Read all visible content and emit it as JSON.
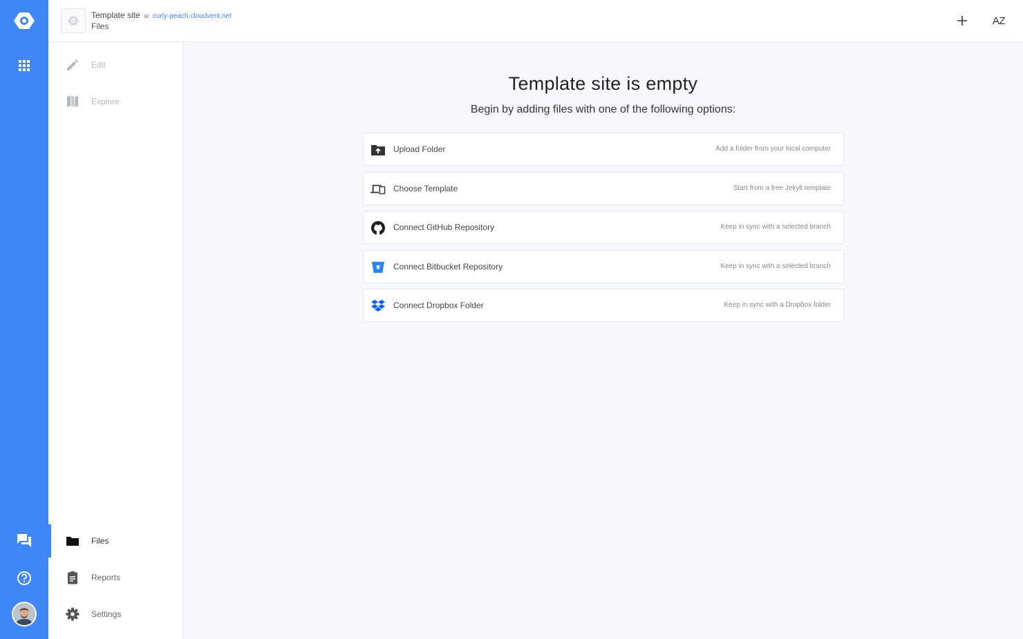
{
  "header": {
    "site_name": "Template site",
    "at_label": "at",
    "site_domain": "curly-peach.cloudvent.net",
    "section": "Files",
    "add_icon": "plus-icon",
    "sort_icon": "sort-az-icon",
    "sort_label": "AZ"
  },
  "rail": {
    "logo_icon": "cloudcannon-logo-icon",
    "apps_icon": "grid-icon",
    "chat_icon": "chat-icon",
    "help_icon": "help-circle-icon",
    "avatar_icon": "user-avatar"
  },
  "sidebar": {
    "top_items": [
      {
        "label": "Edit",
        "icon": "pencil-icon"
      },
      {
        "label": "Explore",
        "icon": "map-icon"
      }
    ],
    "bottom_items": [
      {
        "label": "Files",
        "icon": "folder-icon",
        "active": true
      },
      {
        "label": "Reports",
        "icon": "clipboard-icon"
      },
      {
        "label": "Settings",
        "icon": "gear-icon"
      }
    ]
  },
  "main": {
    "title": "Template site is empty",
    "subtitle": "Begin by adding files with one of the following options:",
    "options": [
      {
        "label": "Upload Folder",
        "description": "Add a folder from your local computer",
        "icon": "folder-upload-icon"
      },
      {
        "label": "Choose Template",
        "description": "Start from a free Jekyll template",
        "icon": "devices-icon"
      },
      {
        "label": "Connect GitHub Repository",
        "description": "Keep in sync with a selected branch",
        "icon": "github-icon"
      },
      {
        "label": "Connect Bitbucket Repository",
        "description": "Keep in sync with a selected branch",
        "icon": "bitbucket-icon"
      },
      {
        "label": "Connect Dropbox Folder",
        "description": "Keep in sync with a Dropbox folder",
        "icon": "dropbox-icon"
      }
    ]
  },
  "colors": {
    "accent": "#3f86f6",
    "background": "#f6f8fd",
    "bitbucket": "#2684ff",
    "dropbox": "#0061fe"
  }
}
